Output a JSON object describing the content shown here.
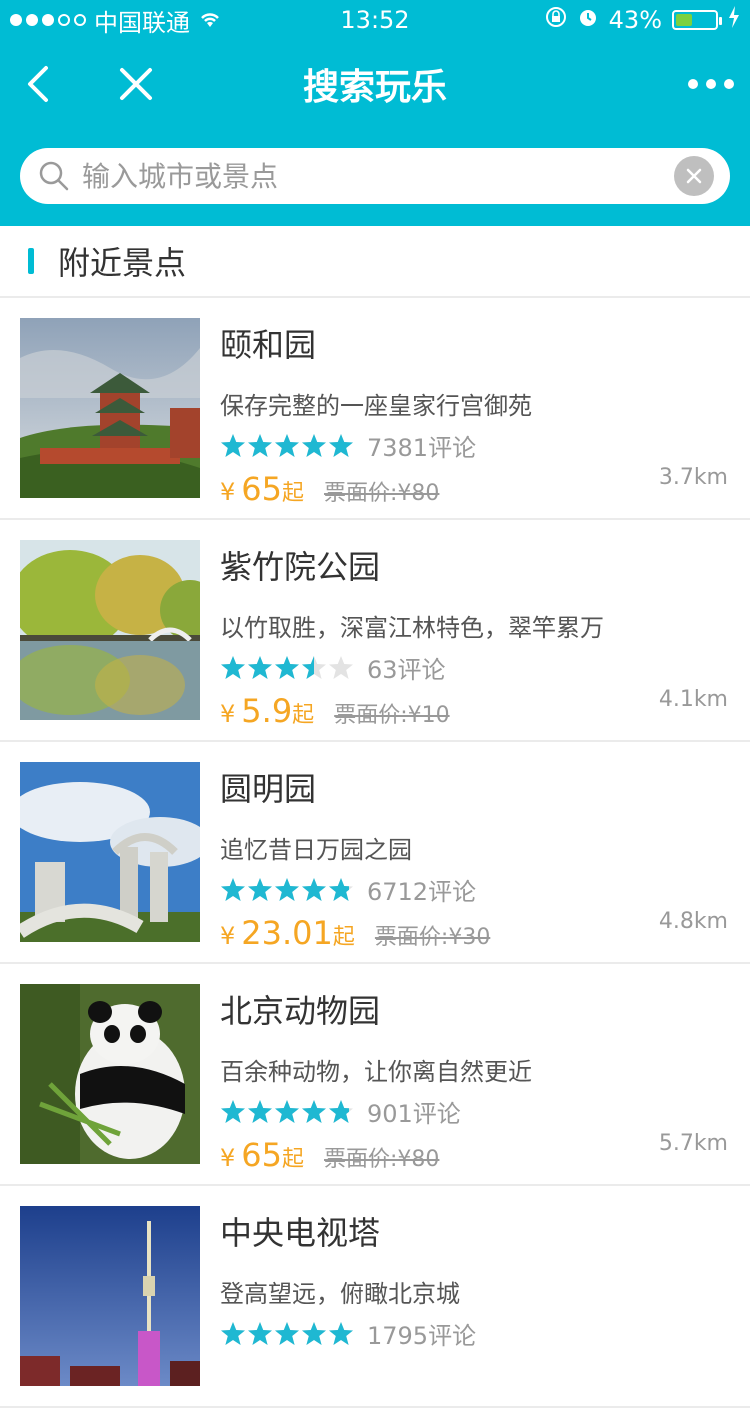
{
  "status": {
    "carrier": "中国联通",
    "time": "13:52",
    "battery_pct": "43%",
    "battery_level": 0.43
  },
  "nav": {
    "title": "搜索玩乐"
  },
  "search": {
    "placeholder": "输入城市或景点"
  },
  "section": {
    "title": "附近景点"
  },
  "colors": {
    "accent": "#00bcd4",
    "price": "#f5a623",
    "star": "#1fb8d2"
  },
  "items": [
    {
      "name": "颐和园",
      "desc": "保存完整的一座皇家行宫御苑",
      "rating": 5,
      "reviews": "7381评论",
      "yen": "¥",
      "price": "65",
      "qi": "起",
      "orig": "票面价:¥80",
      "distance": "3.7km",
      "thumb": "summer-palace"
    },
    {
      "name": "紫竹院公园",
      "desc": "以竹取胜，深富江林特色，翠竿累万",
      "rating": 3.5,
      "reviews": "63评论",
      "yen": "¥",
      "price": "5.9",
      "qi": "起",
      "orig": "票面价:¥10",
      "distance": "4.1km",
      "thumb": "zizhuyuan"
    },
    {
      "name": "圆明园",
      "desc": "追忆昔日万园之园",
      "rating": 4.8,
      "reviews": "6712评论",
      "yen": "¥",
      "price": "23.01",
      "qi": "起",
      "orig": "票面价:¥30",
      "distance": "4.8km",
      "thumb": "yuanmingyuan"
    },
    {
      "name": "北京动物园",
      "desc": "百余种动物，让你离自然更近",
      "rating": 4.8,
      "reviews": "901评论",
      "yen": "¥",
      "price": "65",
      "qi": "起",
      "orig": "票面价:¥80",
      "distance": "5.7km",
      "thumb": "zoo-panda"
    },
    {
      "name": "中央电视塔",
      "desc": "登高望远，俯瞰北京城",
      "rating": 5,
      "reviews": "1795评论",
      "yen": "¥",
      "price": "",
      "qi": "",
      "orig": "",
      "distance": "",
      "thumb": "cctv-tower"
    }
  ]
}
